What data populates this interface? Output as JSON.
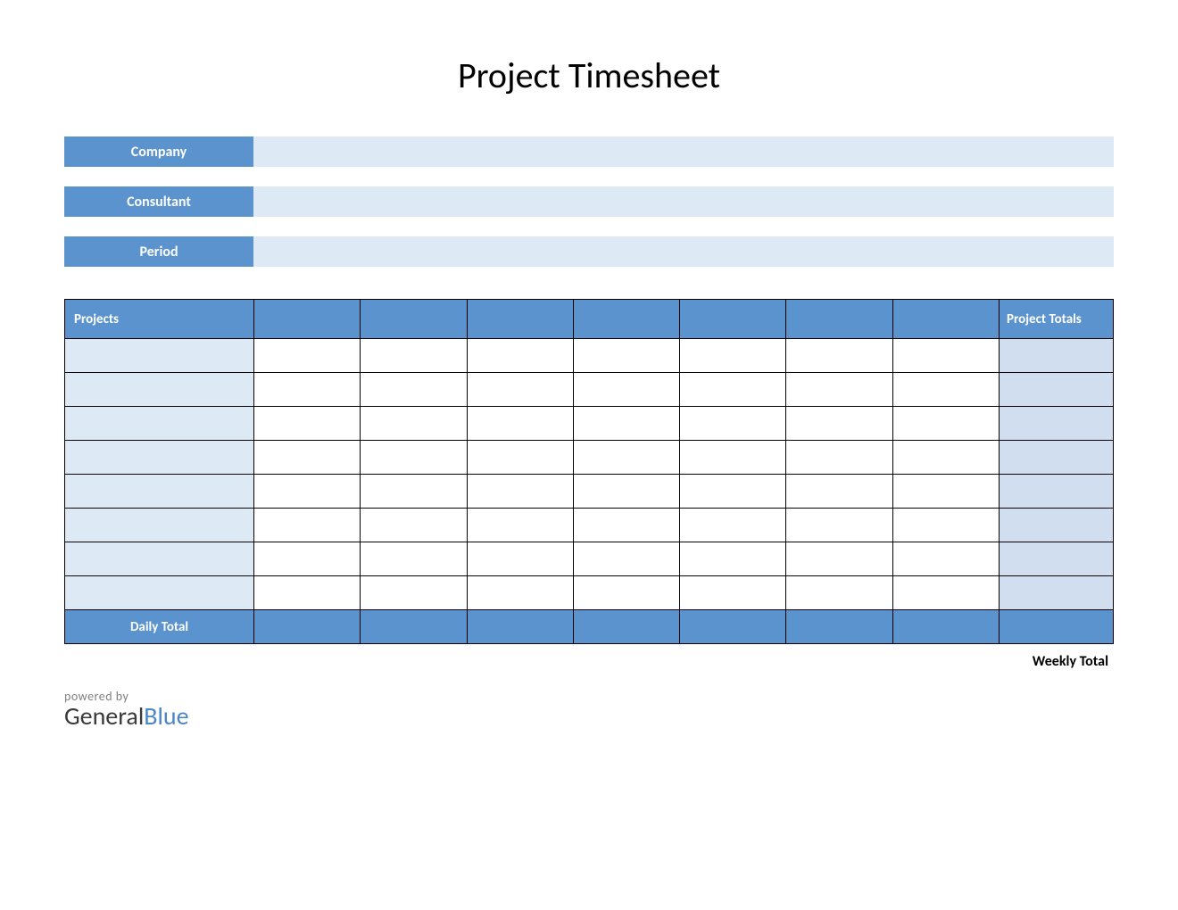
{
  "title": "Project Timesheet",
  "info": {
    "company_label": "Company",
    "company_value": "",
    "consultant_label": "Consultant",
    "consultant_value": "",
    "period_label": "Period",
    "period_value": ""
  },
  "table": {
    "header_projects": "Projects",
    "header_days": [
      "",
      "",
      "",
      "",
      "",
      "",
      ""
    ],
    "header_totals": "Project Totals",
    "rows": [
      {
        "project": "",
        "days": [
          "",
          "",
          "",
          "",
          "",
          "",
          ""
        ],
        "total": ""
      },
      {
        "project": "",
        "days": [
          "",
          "",
          "",
          "",
          "",
          "",
          ""
        ],
        "total": ""
      },
      {
        "project": "",
        "days": [
          "",
          "",
          "",
          "",
          "",
          "",
          ""
        ],
        "total": ""
      },
      {
        "project": "",
        "days": [
          "",
          "",
          "",
          "",
          "",
          "",
          ""
        ],
        "total": ""
      },
      {
        "project": "",
        "days": [
          "",
          "",
          "",
          "",
          "",
          "",
          ""
        ],
        "total": ""
      },
      {
        "project": "",
        "days": [
          "",
          "",
          "",
          "",
          "",
          "",
          ""
        ],
        "total": ""
      },
      {
        "project": "",
        "days": [
          "",
          "",
          "",
          "",
          "",
          "",
          ""
        ],
        "total": ""
      },
      {
        "project": "",
        "days": [
          "",
          "",
          "",
          "",
          "",
          "",
          ""
        ],
        "total": ""
      }
    ],
    "daily_total_label": "Daily Total",
    "daily_totals": [
      "",
      "",
      "",
      "",
      "",
      "",
      ""
    ],
    "grand_total": ""
  },
  "weekly_total_label": "Weekly Total",
  "branding": {
    "powered_by": "powered by",
    "name_part1": "General",
    "name_part2": "Blue"
  }
}
